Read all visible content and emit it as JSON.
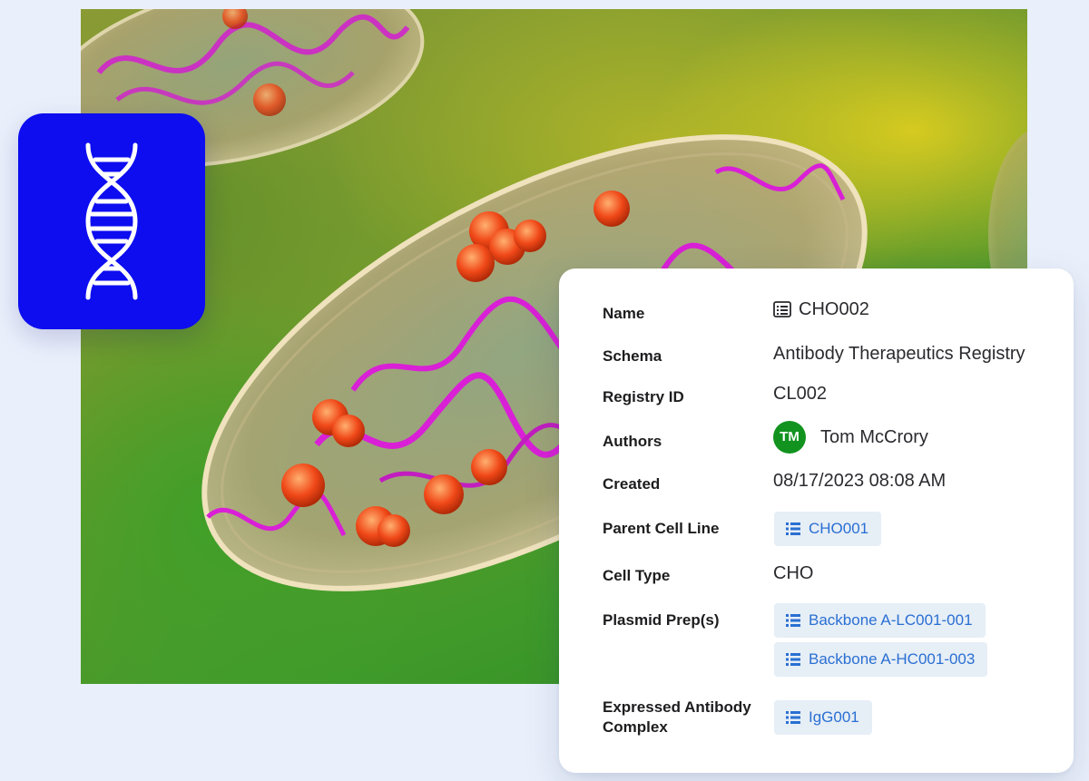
{
  "icons": {
    "app": "dna-icon",
    "entity": "registry-entity-icon"
  },
  "colors": {
    "app_tile": "#0d0df0",
    "avatar": "#12931f",
    "link": "#2a6fd2",
    "chip_bg": "#e6eef6"
  },
  "details": {
    "name_label": "Name",
    "name_value": "CHO002",
    "schema_label": "Schema",
    "schema_value": "Antibody Therapeutics Registry",
    "registry_id_label": "Registry ID",
    "registry_id_value": "CL002",
    "authors_label": "Authors",
    "author_initials": "TM",
    "author_name": "Tom McCrory",
    "created_label": "Created",
    "created_value": "08/17/2023 08:08 AM",
    "parent_cell_line_label": "Parent Cell Line",
    "parent_cell_line_value": "CHO001",
    "cell_type_label": "Cell Type",
    "cell_type_value": "CHO",
    "plasmid_preps_label": "Plasmid Prep(s)",
    "plasmid_preps": [
      "Backbone A-LC001-001",
      "Backbone A-HC001-003"
    ],
    "expressed_antibody_label_line1": "Expressed Antibody",
    "expressed_antibody_label_line2": "Complex",
    "expressed_antibody_value": "IgG001"
  }
}
